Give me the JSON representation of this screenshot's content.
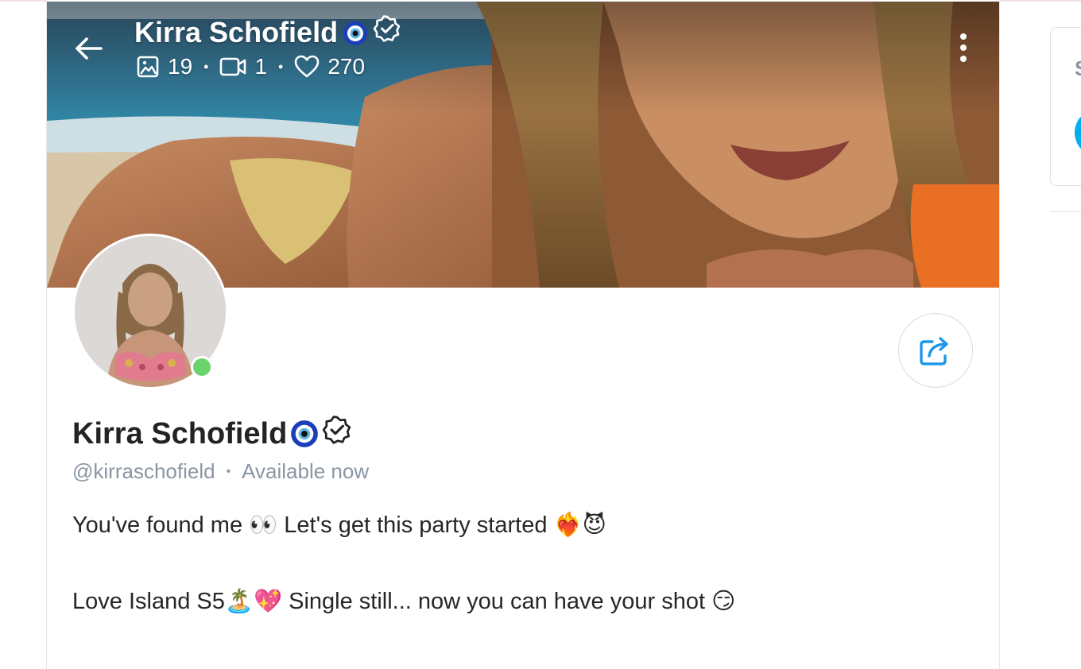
{
  "creator": {
    "name": "Kirra Schofield",
    "name_emoji": "nazar-amulet-emoji",
    "verified_icon": "verified-badge-icon",
    "handle": "@kirraschofield",
    "status": "Available now",
    "online": true
  },
  "header": {
    "stats": {
      "photos_count": "19",
      "videos_count": "1",
      "likes_count": "270"
    }
  },
  "bio": {
    "line1": "You've found me 👀 Let's get this party started ❤️‍🔥😈",
    "line2": "Love Island S5🏝️💖 Single still... now you can have your shot 😏"
  },
  "side_panel": {
    "letter": "S"
  },
  "colors": {
    "muted_text": "#8a96a3",
    "accent_blue": "#00aff0",
    "online_green": "#6bd36b",
    "share_icon_blue": "#1e98e5"
  },
  "icons": [
    "back-arrow-icon",
    "more-vertical-icon",
    "image-icon",
    "video-icon",
    "heart-icon",
    "share-icon",
    "verified-badge-icon"
  ]
}
